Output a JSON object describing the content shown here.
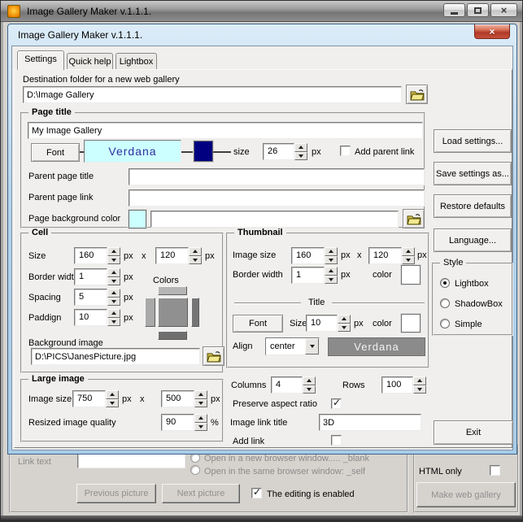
{
  "window": {
    "title": "Image Gallery Maker  v.1.1.1."
  },
  "dialog": {
    "title": "Image Gallery Maker  v.1.1.1.",
    "tabs": [
      {
        "label": "Settings",
        "active": true
      },
      {
        "label": "Quick help",
        "active": false
      },
      {
        "label": "Lightbox",
        "active": false
      }
    ],
    "destination": {
      "label": "Destination folder for a new web gallery",
      "value": "D:\\Image Gallery"
    },
    "page_title": {
      "legend": "Page title",
      "value": "My Image Gallery",
      "font_button": "Font",
      "font_name": "Verdana",
      "size_label": "size",
      "size_value": "26",
      "add_parent_link_label": "Add parent link",
      "add_parent_link_checked": false,
      "parent_title_label": "Parent page title",
      "parent_title_value": "",
      "parent_link_label": "Parent page link",
      "parent_link_value": "",
      "bg_color_label": "Page background color",
      "bg_color_value": ""
    },
    "cell": {
      "legend": "Cell",
      "size_label": "Size",
      "size_w": "160",
      "size_h": "120",
      "border_label": "Border width",
      "border_value": "1",
      "spacing_label": "Spacing",
      "spacing_value": "5",
      "padding_label": "Paddign",
      "padding_value": "10",
      "colors_label": "Colors",
      "bg_image_label": "Background image",
      "bg_image_value": "D:\\PICS\\JanesPicture.jpg"
    },
    "thumbnail": {
      "legend": "Thumbnail",
      "image_size_label": "Image size",
      "size_w": "160",
      "size_h": "120",
      "border_label": "Border width",
      "border_value": "1",
      "color_label": "color",
      "title_divider": "Title",
      "font_button": "Font",
      "size_label": "Size",
      "font_size": "10",
      "align_label": "Align",
      "align_value": "center",
      "font_name": "Verdana"
    },
    "large_image": {
      "legend": "Large image",
      "image_size_label": "Image size",
      "size_w": "750",
      "size_h": "500",
      "quality_label": "Resized image quality",
      "quality_value": "90"
    },
    "grid": {
      "columns_label": "Columns",
      "columns_value": "4",
      "rows_label": "Rows",
      "rows_value": "100",
      "preserve_label": "Preserve aspect ratio",
      "preserve_checked": true,
      "link_title_label": "Image link title",
      "link_title_value": "3D",
      "add_link_label": "Add link",
      "add_link_checked": false
    },
    "side": {
      "load": "Load settings...",
      "save": "Save settings as...",
      "restore": "Restore defaults",
      "language": "Language...",
      "style_legend": "Style",
      "style_options": [
        {
          "label": "Lightbox",
          "selected": true
        },
        {
          "label": "ShadowBox",
          "selected": false
        },
        {
          "label": "Simple",
          "selected": false
        }
      ],
      "exit": "Exit"
    }
  },
  "background_window": {
    "link_text_label": "Link text",
    "link_text_value": "",
    "radio_blank_label": "Open in a new browser window..... _blank",
    "radio_self_label": "Open in the same browser window: _self",
    "previous_button": "Previous picture",
    "next_button": "Next picture",
    "editing_label": "The editing is enabled",
    "editing_checked": true,
    "html_only_label": "HTML only",
    "html_only_checked": false,
    "make_button": "Make web gallery"
  },
  "units": {
    "px": "px",
    "x": "x",
    "percent": "%"
  },
  "icons": {
    "close": "×",
    "check": "✓",
    "folder": "open-folder",
    "spinner_up": "triangle-up",
    "spinner_down": "triangle-down",
    "dropdown": "triangle-down"
  },
  "colors": {
    "page_font_swatch": "#000080",
    "page_bg_swatch": "#ccffff",
    "font_preview_bg": "#ccffff",
    "font_preview_text": "#2e2ea0",
    "thumb_font_bg": "#8b8b8b",
    "thumb_color_swatch": "#ffffff",
    "cell_color_top": "#b5b5b5",
    "cell_color_left": "#a9a9a9",
    "cell_color_center": "#909090",
    "cell_color_right": "#757575",
    "cell_color_bottom": "#6f6f6f",
    "dialog_frame": "#b4d3eb",
    "close_button": "#c0392b"
  }
}
